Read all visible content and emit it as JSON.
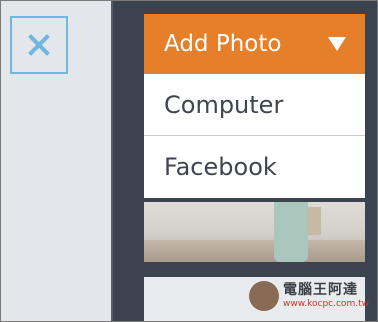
{
  "close_button": {
    "icon": "close-icon",
    "color": "#6fb6e0"
  },
  "dropdown": {
    "title": "Add Photo",
    "icon": "triangle-down-icon",
    "accent": "#e57f29",
    "items": [
      {
        "label": "Computer"
      },
      {
        "label": "Facebook"
      }
    ]
  },
  "watermark": {
    "title": "電腦王阿達",
    "url": "www.kocpc.com.tw"
  }
}
